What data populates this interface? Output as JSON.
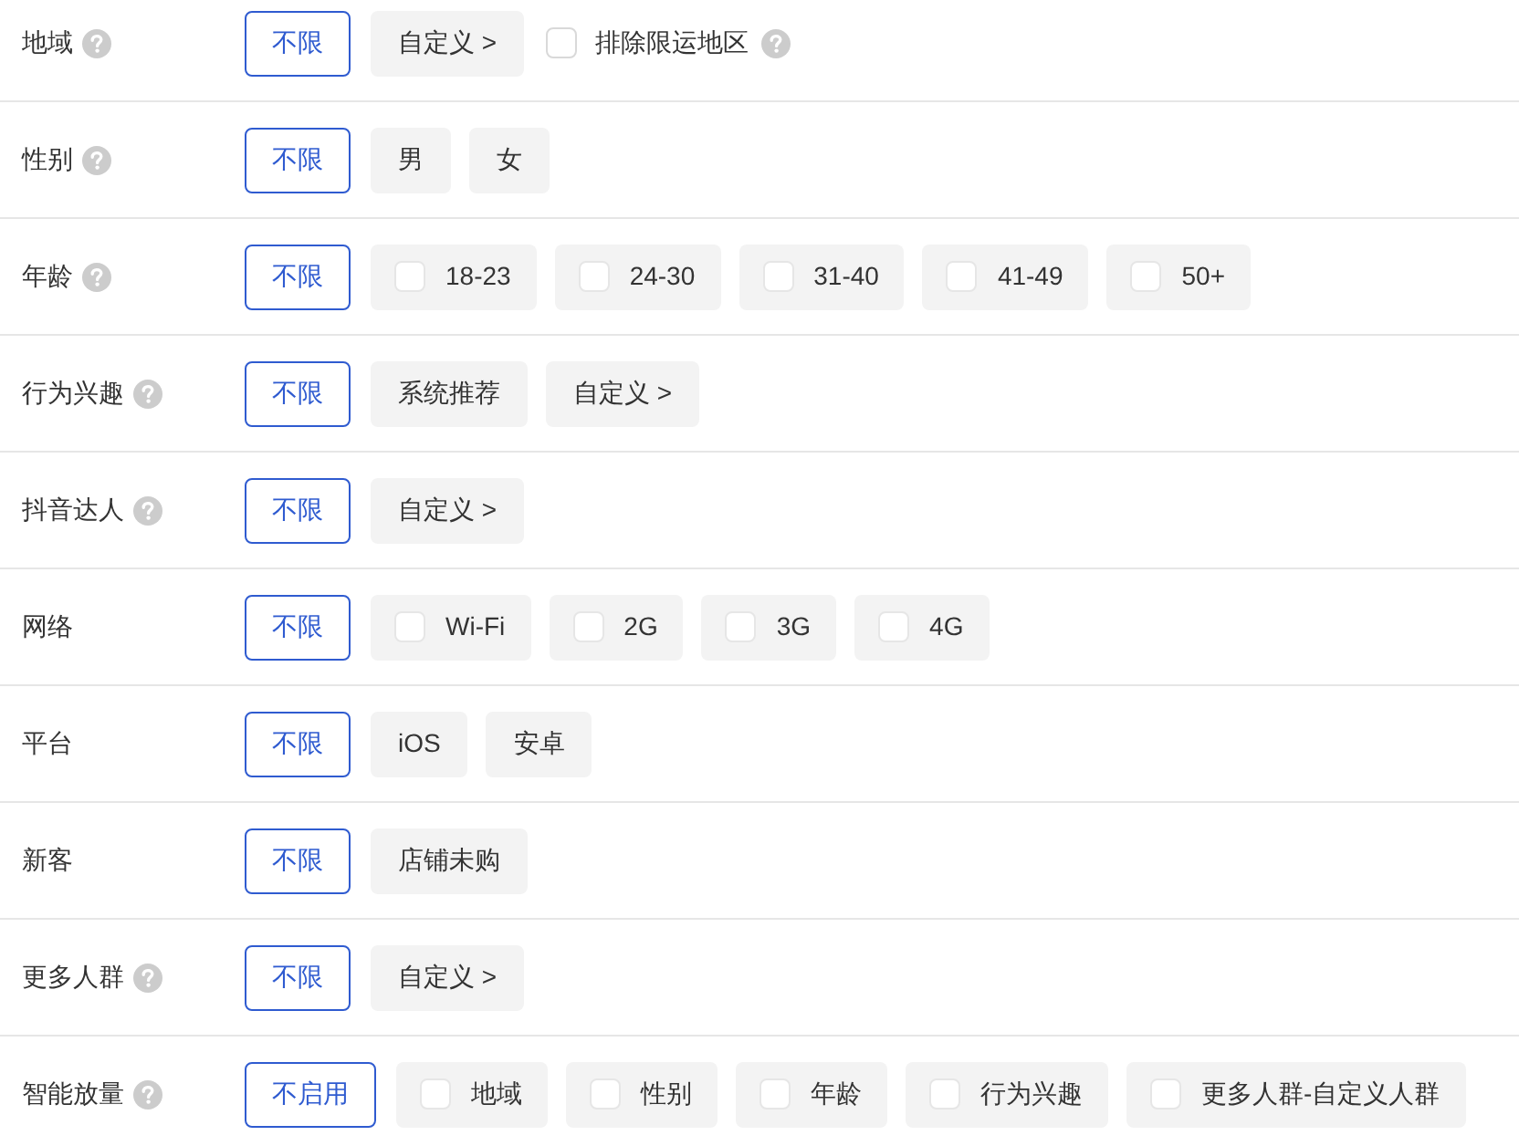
{
  "rows": [
    {
      "label": "地域",
      "help": true,
      "options": [
        {
          "kind": "button",
          "text": "不限",
          "selected": true
        },
        {
          "kind": "button",
          "text": "自定义 >",
          "selected": false
        },
        {
          "kind": "checkbox",
          "text": "排除限运地区",
          "checked": false,
          "help": true
        }
      ]
    },
    {
      "label": "性别",
      "help": true,
      "options": [
        {
          "kind": "button",
          "text": "不限",
          "selected": true
        },
        {
          "kind": "button",
          "text": "男",
          "selected": false
        },
        {
          "kind": "button",
          "text": "女",
          "selected": false
        }
      ]
    },
    {
      "label": "年龄",
      "help": true,
      "options": [
        {
          "kind": "button",
          "text": "不限",
          "selected": true
        },
        {
          "kind": "check_chip",
          "text": "18-23",
          "checked": false
        },
        {
          "kind": "check_chip",
          "text": "24-30",
          "checked": false
        },
        {
          "kind": "check_chip",
          "text": "31-40",
          "checked": false
        },
        {
          "kind": "check_chip",
          "text": "41-49",
          "checked": false
        },
        {
          "kind": "check_chip",
          "text": "50+",
          "checked": false
        }
      ]
    },
    {
      "label": "行为兴趣",
      "help": true,
      "options": [
        {
          "kind": "button",
          "text": "不限",
          "selected": true
        },
        {
          "kind": "button",
          "text": "系统推荐",
          "selected": false
        },
        {
          "kind": "button",
          "text": "自定义 >",
          "selected": false
        }
      ]
    },
    {
      "label": "抖音达人",
      "help": true,
      "options": [
        {
          "kind": "button",
          "text": "不限",
          "selected": true
        },
        {
          "kind": "button",
          "text": "自定义 >",
          "selected": false
        }
      ]
    },
    {
      "label": "网络",
      "help": false,
      "options": [
        {
          "kind": "button",
          "text": "不限",
          "selected": true
        },
        {
          "kind": "check_chip",
          "text": "Wi-Fi",
          "checked": false
        },
        {
          "kind": "check_chip",
          "text": "2G",
          "checked": false
        },
        {
          "kind": "check_chip",
          "text": "3G",
          "checked": false
        },
        {
          "kind": "check_chip",
          "text": "4G",
          "checked": false
        }
      ]
    },
    {
      "label": "平台",
      "help": false,
      "options": [
        {
          "kind": "button",
          "text": "不限",
          "selected": true
        },
        {
          "kind": "button",
          "text": "iOS",
          "selected": false
        },
        {
          "kind": "button",
          "text": "安卓",
          "selected": false
        }
      ]
    },
    {
      "label": "新客",
      "help": false,
      "options": [
        {
          "kind": "button",
          "text": "不限",
          "selected": true
        },
        {
          "kind": "button",
          "text": "店铺未购",
          "selected": false
        }
      ]
    },
    {
      "label": "更多人群",
      "help": true,
      "options": [
        {
          "kind": "button",
          "text": "不限",
          "selected": true
        },
        {
          "kind": "button",
          "text": "自定义 >",
          "selected": false
        }
      ]
    },
    {
      "label": "智能放量",
      "help": true,
      "options": [
        {
          "kind": "button",
          "text": "不启用",
          "selected": true
        },
        {
          "kind": "check_chip",
          "text": "地域",
          "checked": false
        },
        {
          "kind": "check_chip",
          "text": "性别",
          "checked": false
        },
        {
          "kind": "check_chip",
          "text": "年龄",
          "checked": false
        },
        {
          "kind": "check_chip",
          "text": "行为兴趣",
          "checked": false
        },
        {
          "kind": "check_chip",
          "text": "更多人群-自定义人群",
          "checked": false
        }
      ]
    }
  ]
}
